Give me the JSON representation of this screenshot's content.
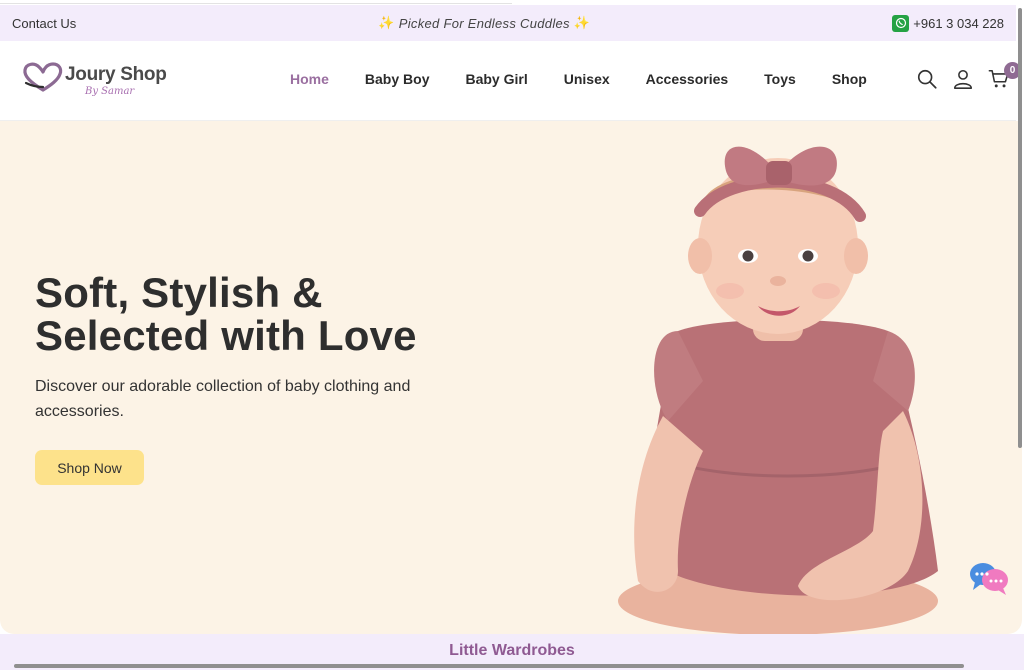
{
  "topbar": {
    "contact_label": "Contact Us",
    "promo_text": "Picked For Endless Cuddles",
    "promo_icon": "sparkle-icon",
    "phone": "+961 3 034 228",
    "phone_icon": "whatsapp-icon"
  },
  "header": {
    "brand_name": "Joury Shop",
    "brand_tagline": "By Samar",
    "nav": [
      {
        "label": "Home",
        "active": true
      },
      {
        "label": "Baby Boy"
      },
      {
        "label": "Baby Girl"
      },
      {
        "label": "Unisex"
      },
      {
        "label": "Accessories"
      },
      {
        "label": "Toys"
      },
      {
        "label": "Shop"
      }
    ],
    "icons": [
      "search-icon",
      "user-icon",
      "cart-icon"
    ],
    "cart_count": "0"
  },
  "hero": {
    "title_line1": "Soft, Stylish &",
    "title_line2": "Selected with Love",
    "description": "Discover our adorable collection of baby clothing and accessories.",
    "cta_label": "Shop Now"
  },
  "section": {
    "title": "Little Wardrobes"
  },
  "colors": {
    "topbar_bg": "#f3ecfb",
    "hero_bg": "#fcf3e6",
    "accent": "#9a6fa0",
    "cta_bg": "#fde28b",
    "whatsapp": "#25a244"
  }
}
